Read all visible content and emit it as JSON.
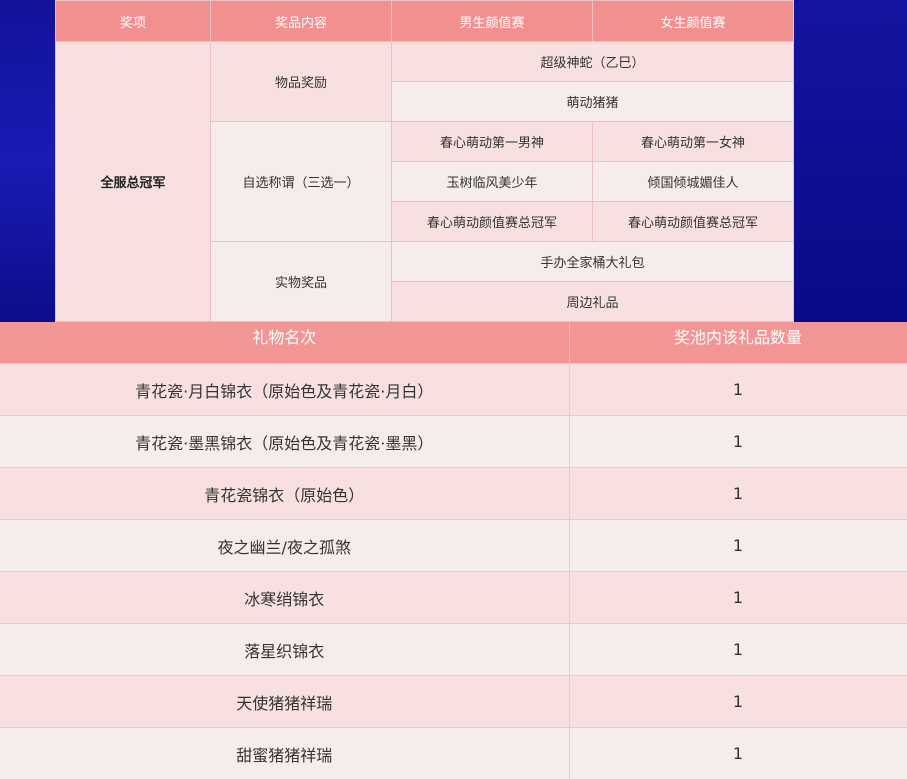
{
  "prize_table": {
    "headers": [
      "奖项",
      "奖品内容",
      "男生颜值赛",
      "女生颜值赛"
    ],
    "award": "全服总冠军",
    "groups": [
      {
        "label": "物品奖励",
        "items": [
          "超级神蛇（乙巳）",
          "萌动猪猪"
        ]
      },
      {
        "label": "自选称谓（三选一）",
        "pairs": [
          [
            "春心萌动第一男神",
            "春心萌动第一女神"
          ],
          [
            "玉树临风美少年",
            "倾国倾城媚佳人"
          ],
          [
            "春心萌动颜值赛总冠军",
            "春心萌动颜值赛总冠军"
          ]
        ]
      },
      {
        "label": "实物奖品",
        "items": [
          "手办全家桶大礼包",
          "周边礼品"
        ]
      }
    ]
  },
  "gift_table": {
    "headers": [
      "礼物名次",
      "奖池内该礼品数量"
    ],
    "rows": [
      {
        "name": "青花瓷·月白锦衣（原始色及青花瓷·月白）",
        "qty": "1"
      },
      {
        "name": "青花瓷·墨黑锦衣（原始色及青花瓷·墨黑）",
        "qty": "1"
      },
      {
        "name": "青花瓷锦衣（原始色）",
        "qty": "1"
      },
      {
        "name": "夜之幽兰/夜之孤煞",
        "qty": "1"
      },
      {
        "name": "冰寒绡锦衣",
        "qty": "1"
      },
      {
        "name": "落星织锦衣",
        "qty": "1"
      },
      {
        "name": "天使猪猪祥瑞",
        "qty": "1"
      },
      {
        "name": "甜蜜猪猪祥瑞",
        "qty": "1"
      }
    ]
  },
  "colors": {
    "header_bg": "#f29090",
    "row_pink": "#f9e0e0",
    "row_light": "#f6ecec",
    "background": "#0f0f9e"
  }
}
